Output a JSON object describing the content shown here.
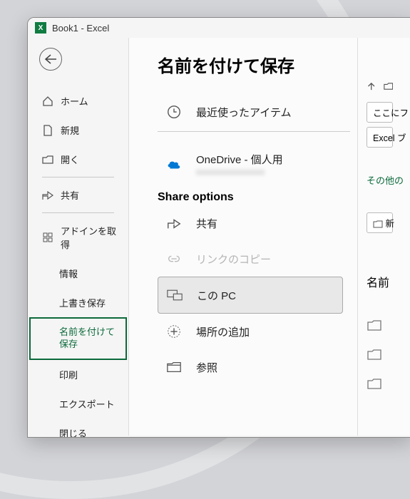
{
  "window": {
    "title": "Book1  -  Excel"
  },
  "page_title": "名前を付けて保存",
  "sidebar": {
    "home": "ホーム",
    "new": "新規",
    "open": "開く",
    "share": "共有",
    "addins": "アドインを取得",
    "info": "情報",
    "save": "上書き保存",
    "saveas": "名前を付けて保存",
    "print": "印刷",
    "export": "エクスポート",
    "close": "閉じる"
  },
  "locations": {
    "recent": "最近使ったアイテム",
    "onedrive_label": "OneDrive - 個人用",
    "onedrive_sub": "xxxxxxxxxxxxxxxx",
    "share_options_title": "Share options",
    "share": "共有",
    "copylink": "リンクのコピー",
    "thispc": "この PC",
    "addplace": "場所の追加",
    "browse": "参照"
  },
  "right": {
    "path_hint": "ここにフ",
    "type_hint": "Excel ブ",
    "other_link": "その他の",
    "new_folder": "新",
    "name_header": "名前"
  }
}
